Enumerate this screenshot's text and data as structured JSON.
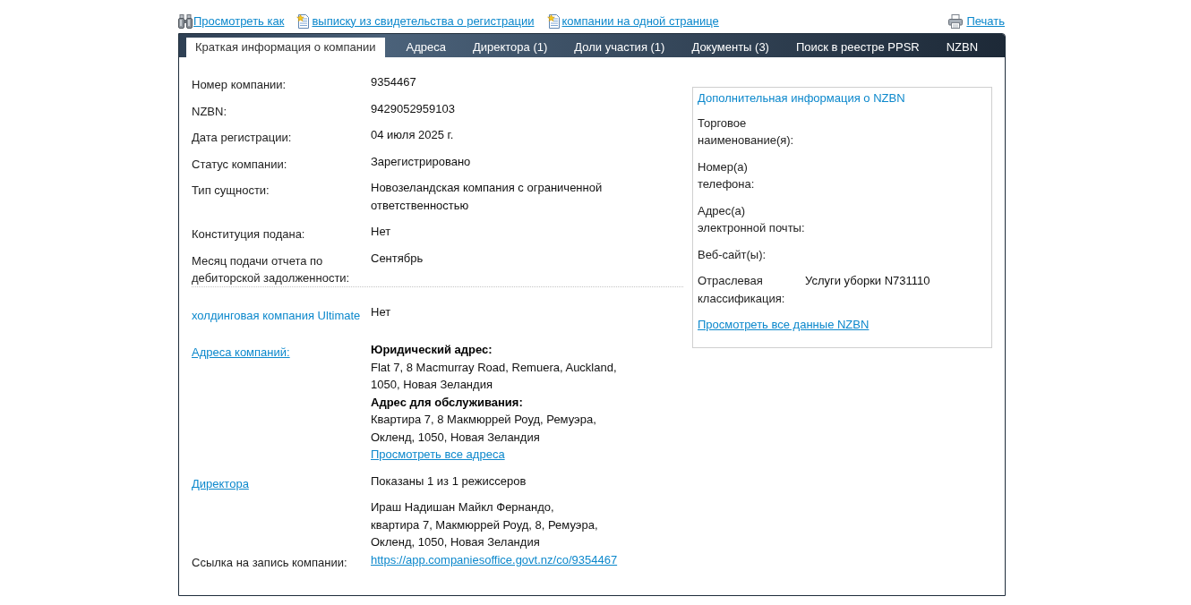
{
  "toolbar": {
    "links": [
      {
        "kind": "binoculars",
        "label": "Просмотреть как"
      },
      {
        "kind": "document",
        "label": "выписку из свидетельства о регистрации"
      },
      {
        "kind": "document",
        "label": "компании на одной странице"
      }
    ],
    "print": {
      "label": "Печать"
    }
  },
  "tabs": [
    {
      "label": "Краткая информация о компании",
      "selected": true
    },
    {
      "label": "Адреса",
      "selected": false
    },
    {
      "label": "Директора (1)",
      "selected": false
    },
    {
      "label": "Доли участия (1)",
      "selected": false
    },
    {
      "label": "Документы (3)",
      "selected": false
    },
    {
      "label": "Поиск в реестре PPSR",
      "selected": false
    },
    {
      "label": "NZBN",
      "selected": false
    }
  ],
  "details": [
    {
      "label": "Номер компании:",
      "value": "9354467"
    },
    {
      "label": "NZBN:",
      "value": "9429052959103"
    },
    {
      "label": "Дата регистрации:",
      "value": "04 июля 2025 г."
    },
    {
      "label": "Статус компании:",
      "value": "Зарегистрировано"
    },
    {
      "label": "Тип сущности:",
      "value": "Новозеландская компания с ограниченной ответственностью"
    },
    {
      "label": "Конституция подана:",
      "value": "Нет"
    },
    {
      "label": "Месяц подачи отчета по дебиторской задолженности:",
      "value": "Сентябрь"
    }
  ],
  "holding": {
    "label": "холдинговая компания Ultimate",
    "value": "Нет"
  },
  "addresses": {
    "label": "Адреса компаний:",
    "entries": [
      {
        "heading": "Юридический адрес:",
        "text": "Flat 7, 8 Macmurray Road, Remuera, Auckland, 1050, Новая Зеландия"
      },
      {
        "heading": "Адрес для обслуживания:",
        "text": "Квартира 7, 8 Макмюррей Роуд, Ремуэра, Окленд, 1050, Новая Зеландия"
      }
    ],
    "link": "Просмотреть все адреса"
  },
  "directors": {
    "label": "Директора",
    "summary": "Показаны 1 из 1 режиссеров",
    "people": [
      {
        "name": "Ираш Надишан Майкл Фернандо,",
        "address": "квартира 7, Макмюррей Роуд, 8, Ремуэра, Окленд, 1050, Новая Зеландия"
      }
    ]
  },
  "record_link": {
    "label": "Ссылка на запись компании:",
    "url": "https://app.companiesoffice.govt.nz/co/9354467"
  },
  "nzbn_panel": {
    "title": "Дополнительная информация о NZBN",
    "fields": [
      {
        "label": "Торговое наименование(я):"
      },
      {
        "label": "Номер(а) телефона:"
      },
      {
        "label": "Адрес(а) электронной почты:"
      },
      {
        "label": "Веб-сайт(ы):"
      },
      {
        "label": "Отраслевая классификация:",
        "value": "Услуги уборки N731110"
      }
    ],
    "link": "Просмотреть все данные NZBN"
  }
}
